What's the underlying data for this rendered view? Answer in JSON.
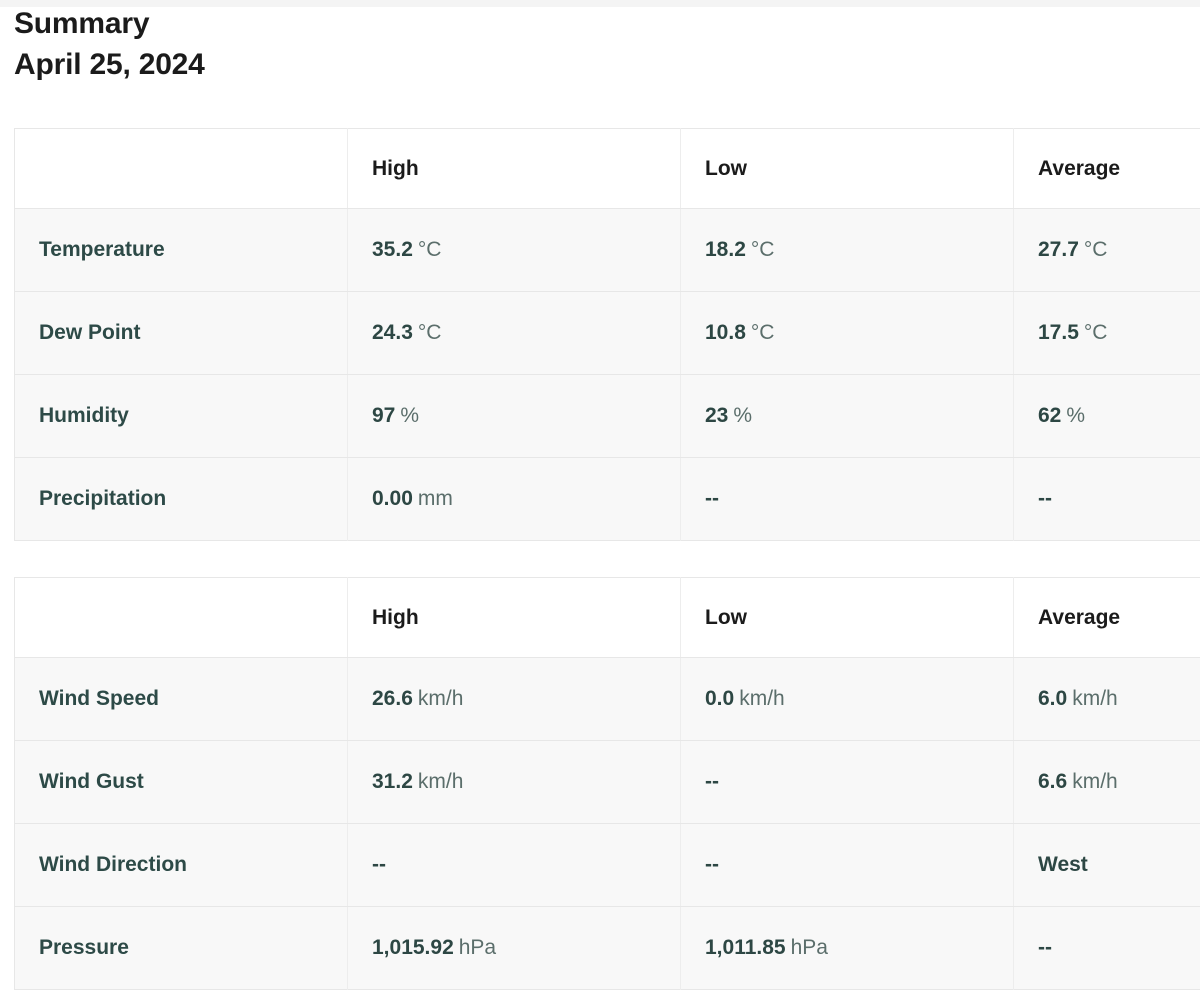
{
  "header": {
    "title": "Summary",
    "date": "April 25, 2024"
  },
  "tables": [
    {
      "id": "conditions-table",
      "columns": [
        "",
        "High",
        "Low",
        "Average"
      ],
      "rows": [
        {
          "label": "Temperature",
          "high": {
            "value": "35.2",
            "unit": "°C"
          },
          "low": {
            "value": "18.2",
            "unit": "°C"
          },
          "average": {
            "value": "27.7",
            "unit": "°C"
          }
        },
        {
          "label": "Dew Point",
          "high": {
            "value": "24.3",
            "unit": "°C"
          },
          "low": {
            "value": "10.8",
            "unit": "°C"
          },
          "average": {
            "value": "17.5",
            "unit": "°C"
          }
        },
        {
          "label": "Humidity",
          "high": {
            "value": "97",
            "unit": "%"
          },
          "low": {
            "value": "23",
            "unit": "%"
          },
          "average": {
            "value": "62",
            "unit": "%"
          }
        },
        {
          "label": "Precipitation",
          "high": {
            "value": "0.00",
            "unit": "mm"
          },
          "low": {
            "value": "--",
            "unit": ""
          },
          "average": {
            "value": "--",
            "unit": ""
          }
        }
      ]
    },
    {
      "id": "wind-table",
      "columns": [
        "",
        "High",
        "Low",
        "Average"
      ],
      "rows": [
        {
          "label": "Wind Speed",
          "high": {
            "value": "26.6",
            "unit": "km/h"
          },
          "low": {
            "value": "0.0",
            "unit": "km/h"
          },
          "average": {
            "value": "6.0",
            "unit": "km/h"
          }
        },
        {
          "label": "Wind Gust",
          "high": {
            "value": "31.2",
            "unit": "km/h"
          },
          "low": {
            "value": "--",
            "unit": ""
          },
          "average": {
            "value": "6.6",
            "unit": "km/h"
          }
        },
        {
          "label": "Wind Direction",
          "high": {
            "value": "--",
            "unit": ""
          },
          "low": {
            "value": "--",
            "unit": ""
          },
          "average": {
            "value": "West",
            "unit": ""
          }
        },
        {
          "label": "Pressure",
          "high": {
            "value": "1,015.92",
            "unit": "hPa"
          },
          "low": {
            "value": "1,011.85",
            "unit": "hPa"
          },
          "average": {
            "value": "--",
            "unit": ""
          }
        }
      ]
    }
  ],
  "colors": {
    "label": "#2d4a47",
    "value": "#2d4744",
    "unit": "#5b6e6b",
    "header_text": "#1b1b1b",
    "row_background": "#f8f8f8",
    "border": "#e7e7e7"
  }
}
